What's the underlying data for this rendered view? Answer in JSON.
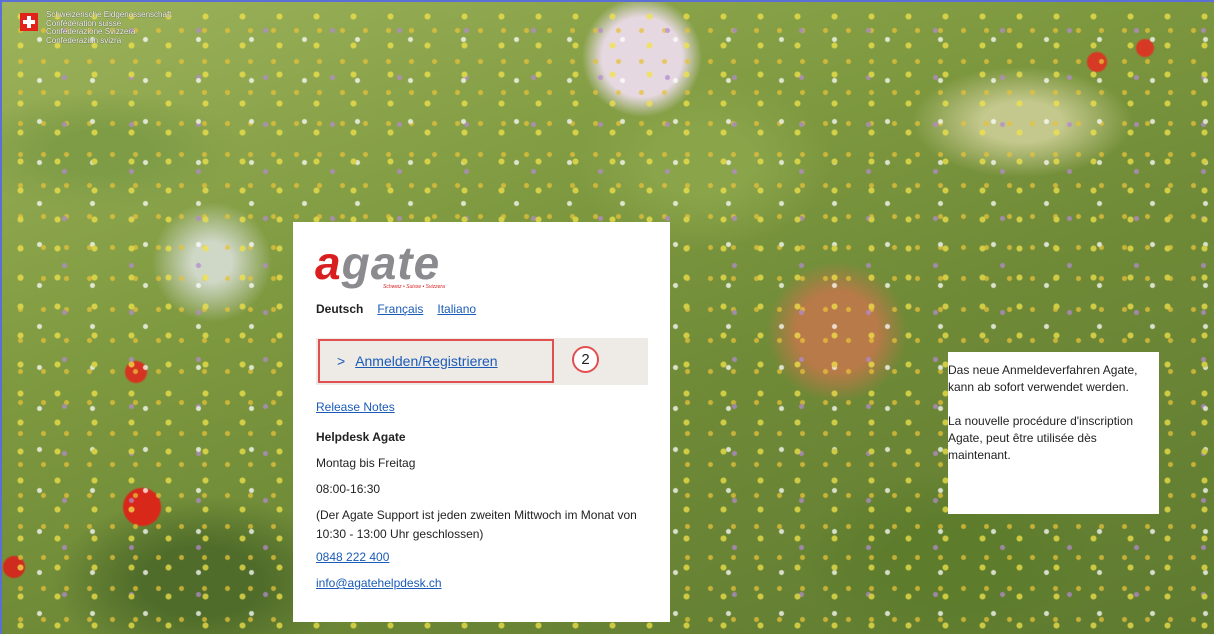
{
  "gov_header": {
    "lines": [
      "Schweizerische Eidgenossenschaft",
      "Confédération suisse",
      "Confederazione Svizzera",
      "Confederaziun svizra"
    ]
  },
  "logo": {
    "brand": "agate",
    "tagline": "Schweiz • Suisse • Svizzera"
  },
  "languages": [
    {
      "label": "Deutsch",
      "active": true
    },
    {
      "label": "Français",
      "active": false
    },
    {
      "label": "Italiano",
      "active": false
    }
  ],
  "login": {
    "chevron": ">",
    "label": "Anmelden/Registrieren",
    "step": "2"
  },
  "info": {
    "release_notes": "Release Notes",
    "helpdesk_title": "Helpdesk Agate",
    "days": "Montag bis Freitag",
    "hours": "08:00-16:30",
    "closure_note": "(Der Agate Support ist jeden zweiten Mittwoch im Monat von 10:30 - 13:00 Uhr geschlossen)",
    "phone": "0848 222 400",
    "email": "info@agatehelpdesk.ch"
  },
  "notice": {
    "de": "Das neue Anmeldeverfahren Agate, kann ab sofort verwendet werden.",
    "fr": "La nouvelle procédure d'inscription Agate, peut être utilisée dès maintenant."
  },
  "colors": {
    "accent_red": "#e15050",
    "link_blue": "#1a5bb8",
    "logo_red": "#d81e1e",
    "logo_gray": "#8b8b8f"
  }
}
